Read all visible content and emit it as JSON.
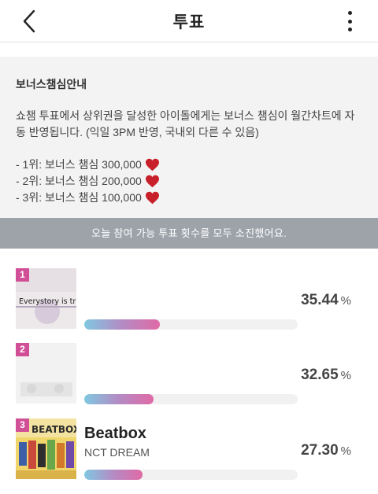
{
  "header": {
    "title": "투표",
    "back_icon": "chevron-left-icon",
    "more_icon": "more-vertical-icon"
  },
  "notice": {
    "title": "보너스챔심안내",
    "body": "쇼챔 투표에서 상위권을 달성한 아이돌에게는 보너스 챔심이 월간차트에 자동 반영됩니다. (익일 3PM 반영, 국내외 다른 수 있음)",
    "rewards": [
      {
        "label": "- 1위: 보너스 챔심 300,000",
        "icon": "heart-icon"
      },
      {
        "label": "- 2위: 보너스 챔심 200,000",
        "icon": "heart-icon"
      },
      {
        "label": "- 3위: 보너스 챔심 100,000",
        "icon": "heart-icon"
      }
    ],
    "heart_color": "#c8202a"
  },
  "banner": {
    "text": "오늘 참여 가능 투표 횟수를 모두 소진했어요."
  },
  "ranking": [
    {
      "rank": "1",
      "title": "",
      "artist": "",
      "percent": "35.44",
      "share": 35.44,
      "cover_text": "Everystory is true a generation",
      "obscured": true
    },
    {
      "rank": "2",
      "title": "",
      "artist": "",
      "percent": "32.65",
      "share": 32.65,
      "cover_text": "",
      "obscured": true
    },
    {
      "rank": "3",
      "title": "Beatbox",
      "artist": "NCT DREAM",
      "percent": "27.30",
      "share": 27.3,
      "cover_text": "BEATBOX",
      "obscured": false
    }
  ],
  "percent_sign": "%",
  "colors": {
    "badge": "#d14f96",
    "banner": "#9ea3aa",
    "bar_start": "#7fc8e0",
    "bar_end": "#e06aa6"
  }
}
